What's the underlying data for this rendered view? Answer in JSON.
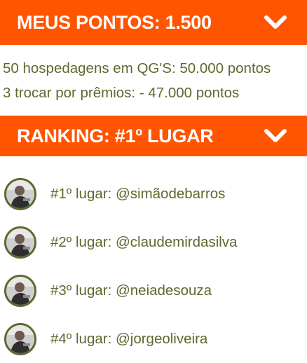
{
  "points": {
    "header_title": "MEUS PONTOS: 1.500",
    "toggle_icon": "chevron-down-icon",
    "lines": [
      "50 hospedagens em QG'S: 50.000 pontos",
      "3 trocar por prêmios: - 47.000 pontos"
    ]
  },
  "ranking": {
    "header_title": "RANKING: #1º LUGAR",
    "toggle_icon": "chevron-down-icon",
    "items": [
      {
        "label": "#1º lugar: @simãodebarros"
      },
      {
        "label": "#2º lugar: @claudemirdasilva"
      },
      {
        "label": "#3º lugar: @neiadesouza"
      },
      {
        "label": "#4º lugar: @jorgeoliveira"
      }
    ]
  },
  "colors": {
    "accent": "#ff5400",
    "text": "#5c6a2e",
    "background": "#ffffff"
  }
}
